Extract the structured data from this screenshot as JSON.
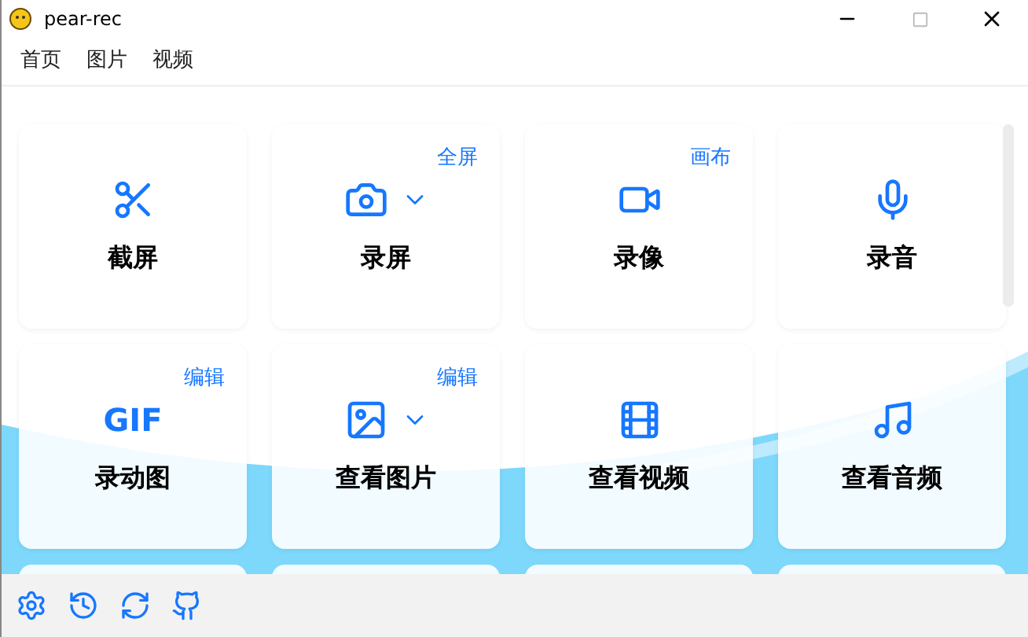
{
  "window": {
    "title": "pear-rec"
  },
  "menu": [
    "首页",
    "图片",
    "视频"
  ],
  "cards": [
    {
      "kind": "scissors",
      "label": "截屏",
      "dropdown": false
    },
    {
      "kind": "camera",
      "label": "录屏",
      "corner": "全屏",
      "dropdown": true
    },
    {
      "kind": "video",
      "label": "录像",
      "corner": "画布",
      "dropdown": false
    },
    {
      "kind": "mic",
      "label": "录音",
      "dropdown": false
    },
    {
      "kind": "text",
      "icon_text": "GIF",
      "label": "录动图",
      "corner": "编辑",
      "dropdown": false
    },
    {
      "kind": "image",
      "label": "查看图片",
      "corner": "编辑",
      "dropdown": true
    },
    {
      "kind": "film",
      "label": "查看视频",
      "dropdown": false
    },
    {
      "kind": "music",
      "label": "查看音频",
      "dropdown": false
    }
  ],
  "footer": [
    {
      "kind": "settings"
    },
    {
      "kind": "history"
    },
    {
      "kind": "refresh"
    },
    {
      "kind": "github"
    }
  ]
}
